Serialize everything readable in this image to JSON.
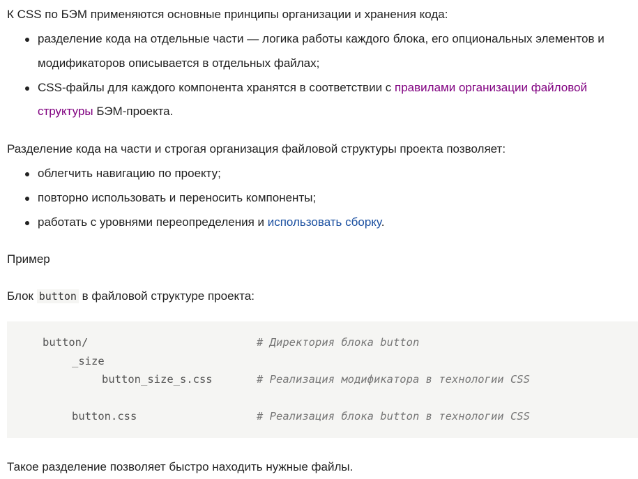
{
  "intro": {
    "text": "К CSS по БЭМ применяются основные принципы организации и хранения кода:"
  },
  "principles": [
    {
      "line1": "разделение кода на отдельные части — логика работы каждого блока, его опциональных элементов и",
      "line2": "модификаторов описывается в отдельных файлах;"
    },
    {
      "line1_prefix": "CSS-файлы для каждого компонента хранятся в соответствии с ",
      "link_line1": "правилами организации файловой",
      "link_line2": "структуры",
      "line2_suffix": " БЭМ-проекта."
    }
  ],
  "benefits_intro": {
    "text": "Разделение кода на части и строгая организация файловой структуры проекта позволяет:"
  },
  "benefits": [
    {
      "text": "облегчить навигацию по проекту;"
    },
    {
      "text": "повторно использовать и переносить компоненты;"
    },
    {
      "prefix": "работать с уровнями переопределения и ",
      "link": "использовать сборку",
      "suffix": "."
    }
  ],
  "example_heading": {
    "text": "Пример"
  },
  "block_caption": {
    "prefix": "Блок ",
    "code": "button",
    "suffix": " в файловой структуре проекта:"
  },
  "code_block": {
    "lines": [
      {
        "path": "button/",
        "comment": "# Директория блока button"
      },
      {
        "path": "_size",
        "comment": ""
      },
      {
        "path": "button_size_s.css",
        "comment": "# Реализация модификатора в технологии CSS"
      },
      {
        "path": "button.css",
        "comment": "# Реализация блока button в технологии CSS"
      }
    ]
  },
  "conclusion": {
    "text": "Такое разделение позволяет быстро находить нужные файлы."
  }
}
